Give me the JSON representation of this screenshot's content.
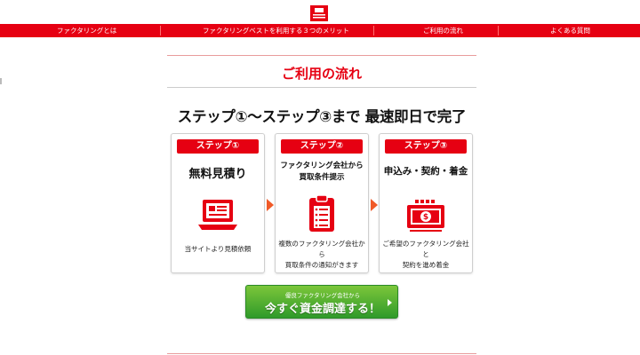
{
  "nav": {
    "items": [
      {
        "label": "ファクタリングとは"
      },
      {
        "label": "ファクタリングベストを利用する３つのメリット"
      },
      {
        "label": "ご利用の流れ"
      },
      {
        "label": "よくある質問"
      }
    ]
  },
  "section": {
    "title": "ご利用の流れ",
    "headline": "ステップ①～ステップ③まで 最速即日で完了"
  },
  "steps": [
    {
      "label": "ステップ①",
      "title": "無料見積り",
      "desc": "当サイトより見積依頼",
      "icon": "laptop-icon"
    },
    {
      "label": "ステップ②",
      "title_line1": "ファクタリング会社から",
      "title_line2": "買取条件提示",
      "desc_line1": "複数のファクタリング会社から",
      "desc_line2": "買取条件の通知がきます",
      "icon": "clipboard-icon"
    },
    {
      "label": "ステップ③",
      "title": "申込み・契約・着金",
      "desc_line1": "ご希望のファクタリング会社と",
      "desc_line2": "契約を進め着金",
      "icon": "money-icon"
    }
  ],
  "cta": {
    "small": "優良ファクタリング会社から",
    "big": "今すぐ資金調達する！"
  },
  "colors": {
    "brand_red": "#e60012",
    "arrow_orange": "#f05a28",
    "cta_green": "#3aa52f"
  }
}
